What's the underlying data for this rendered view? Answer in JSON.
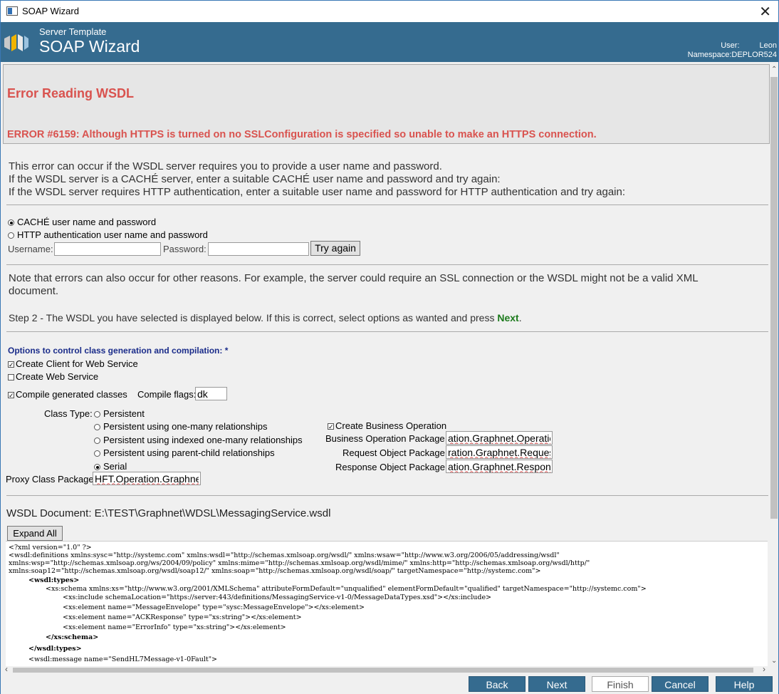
{
  "window": {
    "title": "SOAP Wizard",
    "close_glyph": "✕"
  },
  "header": {
    "subtitle": "Server Template",
    "title": "SOAP Wizard",
    "user_label": "User:",
    "user_value": "Leon",
    "namespace_label": "Namespace:",
    "namespace_value": "DEPLOR524"
  },
  "error": {
    "heading": "Error Reading WSDL",
    "message": "ERROR #6159: Although HTTPS is turned on no SSLConfiguration is specified so unable to make an HTTPS connection."
  },
  "help_lines": [
    "This error can occur if the WSDL server requires you to provide a user name and password.",
    "If the WSDL server is a CACHÉ server, enter a suitable CACHÉ user name and password and try again:",
    "If the WSDL server requires HTTP authentication, enter a suitable user name and password for HTTP authentication and try again:"
  ],
  "auth": {
    "option_cache": "CACHÉ user name and password",
    "option_http": "HTTP authentication user name and password",
    "username_label": "Username:",
    "password_label": "Password:",
    "username_value": "",
    "password_value": "",
    "try_again": "Try again"
  },
  "note_lines": [
    "Note that errors can also occur for other reasons. For example, the server could require an SSL connection or the WSDL might not be a valid XML",
    "document."
  ],
  "step2": {
    "before": "Step 2 - The WSDL you have selected is displayed below. If this is correct, select options as wanted and press ",
    "next_word": "Next",
    "after": "."
  },
  "options": {
    "heading": "Options to control class generation and compilation: *",
    "create_client": "Create Client for Web Service",
    "create_service": "Create Web Service",
    "compile_generated": "Compile generated classes",
    "compile_flags_label": "Compile flags:",
    "compile_flags_value": "dk",
    "class_type_label": "Class Type:",
    "class_types": [
      "Persistent",
      "Persistent using one-many relationships",
      "Persistent using indexed one-many relationships",
      "Persistent using parent-child relationships",
      "Serial"
    ],
    "create_business_operation": "Create Business Operation",
    "bo_package_label": "Business Operation Package",
    "bo_package_value": "ation.Graphnet.Operation",
    "req_package_label": "Request Object Package",
    "req_package_value": "ration.Graphnet.Request",
    "resp_package_label": "Response Object Package",
    "resp_package_value": "ation.Graphnet.Response",
    "proxy_label": "Proxy Class Package",
    "proxy_value": "HFT.Operation.Graphnet"
  },
  "wsdl": {
    "label": "WSDL Document:",
    "path": "E:\\TEST\\Graphnet\\WDSL\\MessagingService.wsdl",
    "expand_all": "Expand All",
    "xml_lines": [
      "<?xml version=\"1.0\" ?>",
      "<wsdl:definitions xmlns:sysc=\"http://systemc.com\" xmlns:wsdl=\"http://schemas.xmlsoap.org/wsdl/\" xmlns:wsaw=\"http://www.w3.org/2006/05/addressing/wsdl\"",
      "xmlns:wsp=\"http://schemas.xmlsoap.org/ws/2004/09/policy\" xmlns:mime=\"http://schemas.xmlsoap.org/wsdl/mime/\" xmlns:http=\"http://schemas.xmlsoap.org/wsdl/http/\"",
      "xmlns:soap12=\"http://schemas.xmlsoap.org/wsdl/soap12/\" xmlns:soap=\"http://schemas.xmlsoap.org/wsdl/soap/\" targetNamespace=\"http://systemc.com\">",
      "<wsdl:types>",
      "<xs:schema xmlns:xs=\"http://www.w3.org/2001/XMLSchema\" attributeFormDefault=\"unqualified\" elementFormDefault=\"qualified\" targetNamespace=\"http://systemc.com\">",
      "<xs:include schemaLocation=\"https://server:443/definitions/MessagingService-v1-0/MessageDataTypes.xsd\"></xs:include>",
      "<xs:element name=\"MessageEnvelope\" type=\"sysc:MessageEnvelope\"></xs:element>",
      "<xs:element name=\"ACKResponse\" type=\"xs:string\"></xs:element>",
      "<xs:element name=\"ErrorInfo\" type=\"xs:string\"></xs:element>",
      "</xs:schema>",
      "</wsdl:types>",
      "<wsdl:message name=\"SendHL7Message-v1-0Fault\">"
    ]
  },
  "footer": {
    "back": "Back",
    "next": "Next",
    "finish": "Finish",
    "cancel": "Cancel",
    "help": "Help"
  },
  "colors": {
    "header_bg": "#356b8f",
    "error_red": "#d9534f",
    "option_heading_blue": "#1a2c8a",
    "next_green": "#1c7a1c"
  }
}
